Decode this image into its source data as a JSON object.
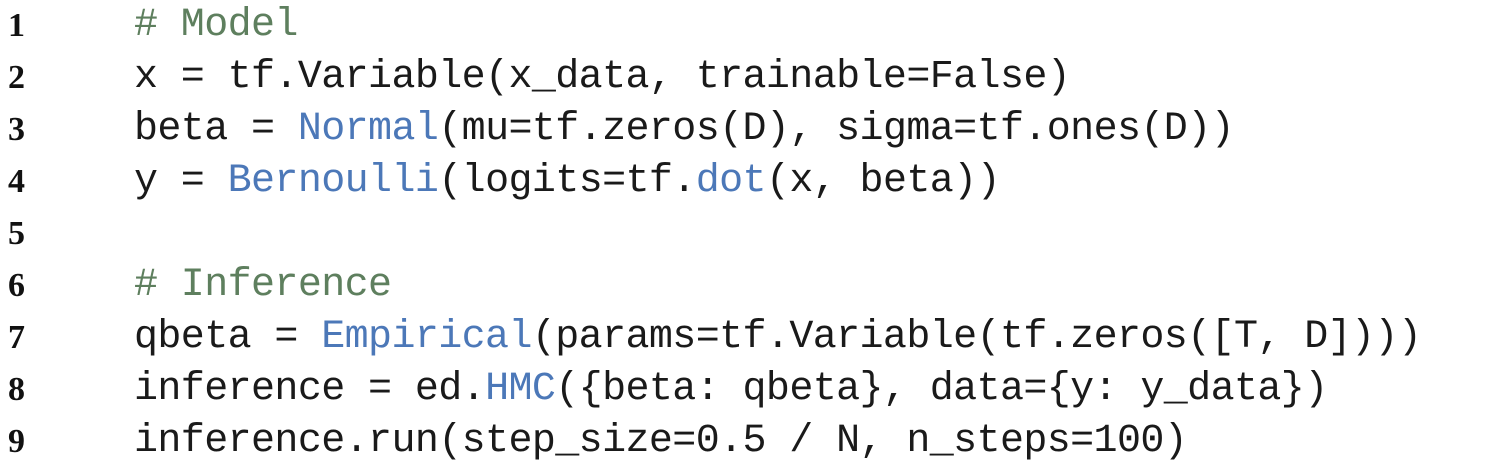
{
  "listing": {
    "lines": [
      {
        "number": "1",
        "tokens": [
          {
            "text": "# Model",
            "kind": "comment"
          }
        ]
      },
      {
        "number": "2",
        "tokens": [
          {
            "text": "x = tf.Variable(x_data, trainable=False)",
            "kind": "plain"
          }
        ]
      },
      {
        "number": "3",
        "tokens": [
          {
            "text": "beta = ",
            "kind": "plain"
          },
          {
            "text": "Normal",
            "kind": "class"
          },
          {
            "text": "(mu=tf.zeros(D), sigma=tf.ones(D))",
            "kind": "plain"
          }
        ]
      },
      {
        "number": "4",
        "tokens": [
          {
            "text": "y = ",
            "kind": "plain"
          },
          {
            "text": "Bernoulli",
            "kind": "class"
          },
          {
            "text": "(logits=tf.",
            "kind": "plain"
          },
          {
            "text": "dot",
            "kind": "class"
          },
          {
            "text": "(x, beta))",
            "kind": "plain"
          }
        ]
      },
      {
        "number": "5",
        "tokens": []
      },
      {
        "number": "6",
        "tokens": [
          {
            "text": "# Inference",
            "kind": "comment"
          }
        ]
      },
      {
        "number": "7",
        "tokens": [
          {
            "text": "qbeta = ",
            "kind": "plain"
          },
          {
            "text": "Empirical",
            "kind": "class"
          },
          {
            "text": "(params=tf.Variable(tf.zeros([T, D])))",
            "kind": "plain"
          }
        ]
      },
      {
        "number": "8",
        "tokens": [
          {
            "text": "inference = ed.",
            "kind": "plain"
          },
          {
            "text": "HMC",
            "kind": "class"
          },
          {
            "text": "({beta: qbeta}, data={y: y_data})",
            "kind": "plain"
          }
        ]
      },
      {
        "number": "9",
        "tokens": [
          {
            "text": "inference.run(step_size=0.5 / N, n_steps=100)",
            "kind": "plain"
          }
        ]
      }
    ]
  }
}
